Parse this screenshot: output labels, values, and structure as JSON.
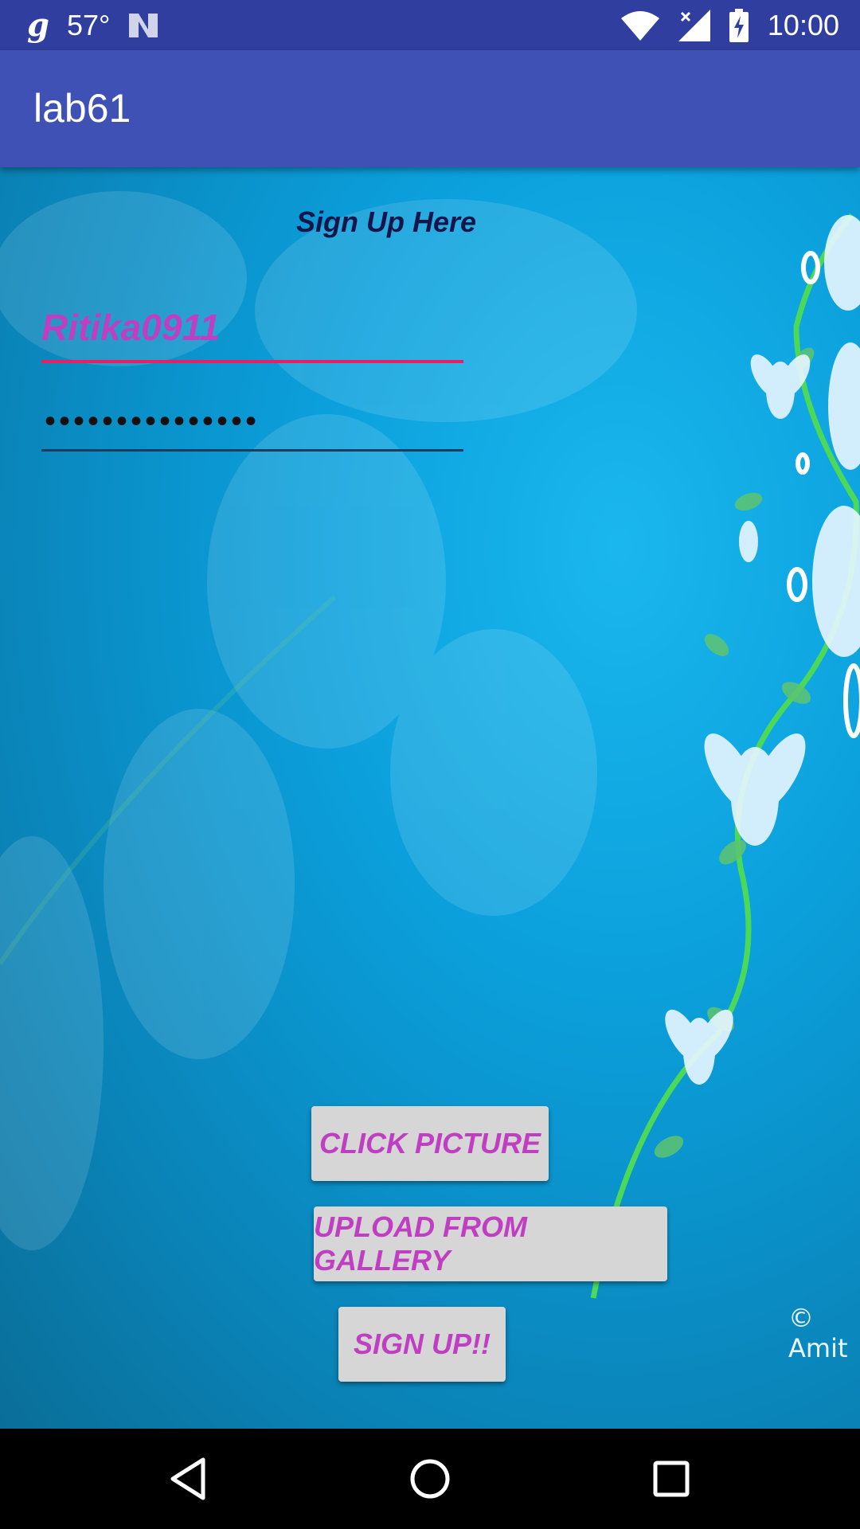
{
  "status_bar": {
    "app_icon": "g",
    "temperature": "57°",
    "time": "10:00",
    "icons": [
      "n-icon",
      "wifi-icon",
      "signal-icon",
      "battery-charging-icon"
    ]
  },
  "app_bar": {
    "title": "lab61"
  },
  "form": {
    "heading": "Sign Up Here",
    "username_value": "Ritika0911",
    "password_value": "•••••••••••••••"
  },
  "buttons": {
    "click_picture": "CLICK PICTURE",
    "upload_gallery": "UPLOAD FROM GALLERY",
    "sign_up": "SIGN UP!!"
  },
  "watermark": "© Amit",
  "nav": [
    "back-icon",
    "home-icon",
    "recents-icon"
  ],
  "colors": {
    "status_bar": "#303f9f",
    "app_bar": "#3f51b5",
    "accent": "#e91e63",
    "button_text": "#c03ec2"
  }
}
